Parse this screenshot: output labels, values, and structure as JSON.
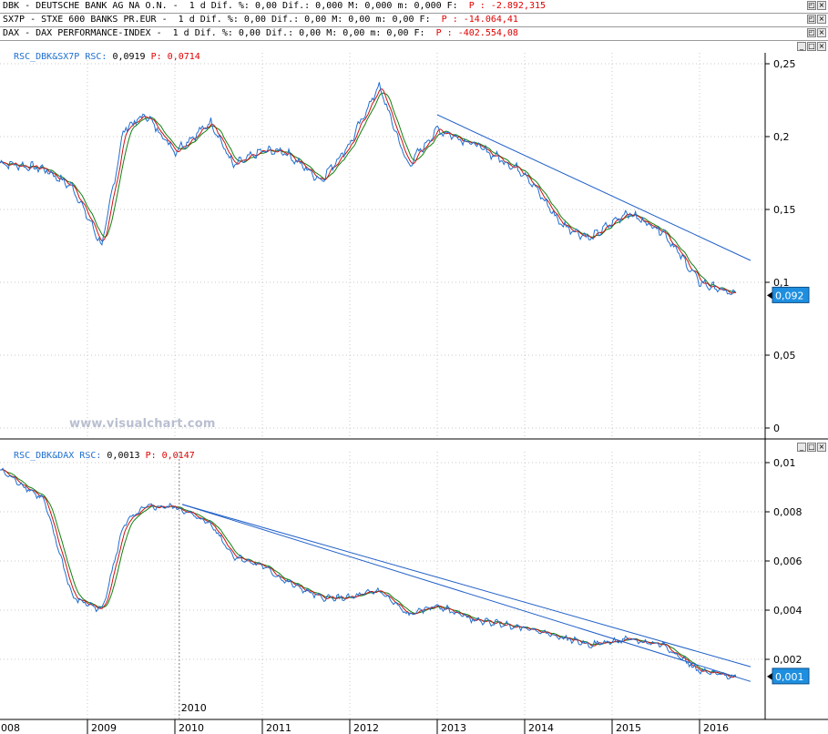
{
  "headers": [
    {
      "label": "DBK - DEUTSCHE BANK AG NA O.N. -  1 d Dif. %: 0,00 Dif.: 0,000 M: 0,000 m: 0,000 F:",
      "value": "P : -2.892,315"
    },
    {
      "label": "SX7P - STXE 600 BANKS PR.EUR -  1 d Dif. %: 0,00 Dif.: 0,00 M: 0,00 m: 0,00 F:",
      "value": "P : -14.064,41"
    },
    {
      "label": "DAX - DAX PERFORMANCE-INDEX -  1 d Dif. %: 0,00 Dif.: 0,00 M: 0,00 m: 0,00 F:",
      "value": "P : -402.554,08"
    }
  ],
  "window_buttons": {
    "restore": "◰",
    "maximize": "□",
    "close": "×"
  },
  "watermark": "www.visualchart.com",
  "panels": [
    {
      "title": "RSC_DBK&SX7P RSC:",
      "value": "0,0919",
      "p_label": "P:",
      "p_value": "0,0714",
      "last_label": "0,092"
    },
    {
      "title": "RSC_DBK&DAX RSC:",
      "value": "0,0013",
      "p_label": "P:",
      "p_value": "0,0147",
      "last_label": "0,001"
    }
  ],
  "x_axis": {
    "labels": [
      "008",
      "2009",
      "2010",
      "2011",
      "2012",
      "2013",
      "2014",
      "2015",
      "2016"
    ],
    "marker_label": "2010"
  },
  "colors": {
    "trendline": "#1f5fc8",
    "price": "#1f6fd0",
    "ma_fast": "#d01010",
    "ma_slow": "#108010",
    "label_bg": "#1e8fe0"
  },
  "chart_data": [
    {
      "type": "line",
      "title": "RSC_DBK&SX7P",
      "x": [
        "2008-01",
        "2008-07",
        "2008-11",
        "2009-03",
        "2009-06",
        "2009-09",
        "2010-01",
        "2010-06",
        "2010-09",
        "2011-01",
        "2011-04",
        "2011-09",
        "2012-01",
        "2012-05",
        "2012-09",
        "2013-01",
        "2013-06",
        "2014-01",
        "2014-06",
        "2014-10",
        "2015-03",
        "2015-08",
        "2016-01",
        "2016-06"
      ],
      "series": [
        {
          "values": [
            0.182,
            0.178,
            0.165,
            0.125,
            0.205,
            0.215,
            0.19,
            0.21,
            0.18,
            0.19,
            0.19,
            0.17,
            0.195,
            0.235,
            0.18,
            0.205,
            0.195,
            0.175,
            0.14,
            0.13,
            0.148,
            0.135,
            0.1,
            0.091
          ]
        }
      ],
      "ylim": [
        0,
        0.25
      ],
      "yticks": [
        "0",
        "0,05",
        "0,1",
        "0,15",
        "0,2",
        "0,25"
      ],
      "trendline": {
        "from": [
          "2013-01",
          0.215
        ],
        "to": [
          "2016-08",
          0.115
        ]
      }
    },
    {
      "type": "line",
      "title": "RSC_DBK&DAX",
      "x": [
        "2008-01",
        "2008-07",
        "2008-11",
        "2009-03",
        "2009-06",
        "2009-09",
        "2010-01",
        "2010-06",
        "2010-09",
        "2011-01",
        "2011-04",
        "2011-09",
        "2012-01",
        "2012-05",
        "2012-09",
        "2013-01",
        "2013-06",
        "2014-01",
        "2014-06",
        "2014-10",
        "2015-03",
        "2015-08",
        "2016-01",
        "2016-06"
      ],
      "series": [
        {
          "values": [
            0.0097,
            0.0085,
            0.0045,
            0.004,
            0.0075,
            0.0082,
            0.0082,
            0.0075,
            0.0062,
            0.0058,
            0.0052,
            0.0045,
            0.0045,
            0.0048,
            0.0038,
            0.0042,
            0.0036,
            0.0033,
            0.0029,
            0.0026,
            0.0028,
            0.0026,
            0.0015,
            0.0013
          ]
        }
      ],
      "ylim": [
        0,
        0.01
      ],
      "yticks": [
        "0,002",
        "0,004",
        "0,006",
        "0,008",
        "0,01"
      ],
      "trendlines": [
        {
          "from": [
            "2010-02",
            0.0083
          ],
          "to": [
            "2016-08",
            0.0017
          ]
        },
        {
          "from": [
            "2010-02",
            0.0083
          ],
          "to": [
            "2016-08",
            0.0011
          ]
        }
      ]
    }
  ]
}
